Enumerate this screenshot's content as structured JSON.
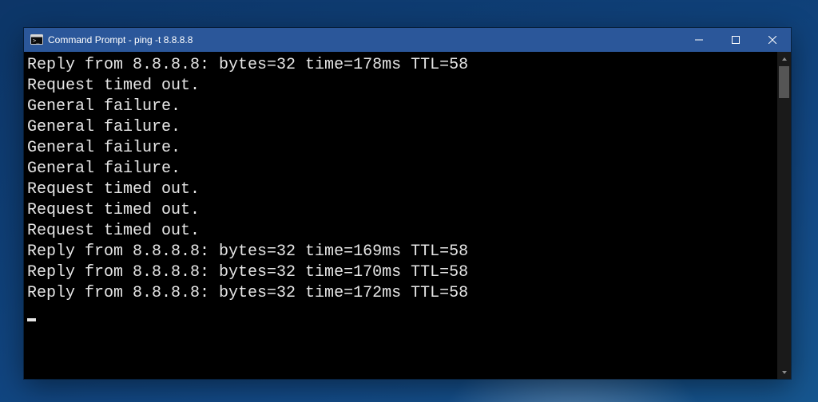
{
  "window": {
    "title": "Command Prompt - ping  -t 8.8.8.8"
  },
  "terminal": {
    "lines": [
      "Reply from 8.8.8.8: bytes=32 time=178ms TTL=58",
      "Request timed out.",
      "General failure.",
      "General failure.",
      "General failure.",
      "General failure.",
      "Request timed out.",
      "Request timed out.",
      "Request timed out.",
      "Reply from 8.8.8.8: bytes=32 time=169ms TTL=58",
      "Reply from 8.8.8.8: bytes=32 time=170ms TTL=58",
      "Reply from 8.8.8.8: bytes=32 time=172ms TTL=58"
    ]
  }
}
